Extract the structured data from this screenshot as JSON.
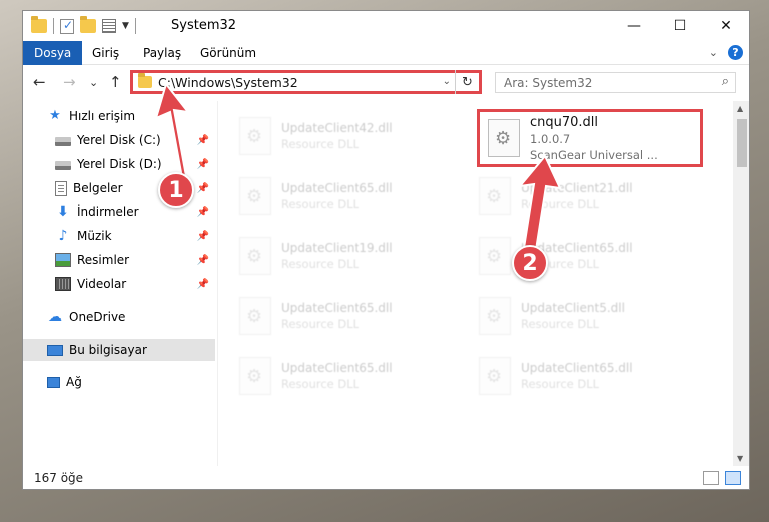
{
  "window": {
    "title": "System32",
    "controls": {
      "minimize": "—",
      "maximize": "☐",
      "close": "✕"
    }
  },
  "ribbon": {
    "tabs": [
      {
        "label": "Dosya",
        "active": true
      },
      {
        "label": "Giriş",
        "active": false
      },
      {
        "label": "Paylaş",
        "active": false
      },
      {
        "label": "Görünüm",
        "active": false
      }
    ],
    "help": "?",
    "collapse": "⌄"
  },
  "nav": {
    "back": "←",
    "forward": "→",
    "recent": "⌄",
    "up": "↑"
  },
  "address": {
    "path": "C:\\Windows\\System32",
    "dropdown": "⌄",
    "refresh": "↻"
  },
  "search": {
    "placeholder": "Ara: System32",
    "icon": "⌕"
  },
  "sidebar": {
    "items": [
      {
        "label": "Hızlı erişim",
        "icon": "star-icon",
        "pinned": false
      },
      {
        "label": "Yerel Disk (C:)",
        "icon": "disk-icon",
        "pinned": true
      },
      {
        "label": "Yerel Disk (D:)",
        "icon": "disk-icon",
        "pinned": true
      },
      {
        "label": "Belgeler",
        "icon": "document-icon",
        "pinned": true
      },
      {
        "label": "İndirmeler",
        "icon": "download-icon",
        "pinned": true
      },
      {
        "label": "Müzik",
        "icon": "music-icon",
        "pinned": true
      },
      {
        "label": "Resimler",
        "icon": "pictures-icon",
        "pinned": true
      },
      {
        "label": "Videolar",
        "icon": "videos-icon",
        "pinned": true
      },
      {
        "label": "OneDrive",
        "icon": "cloud-icon",
        "pinned": false
      },
      {
        "label": "Bu bilgisayar",
        "icon": "computer-icon",
        "pinned": false,
        "selected": true
      },
      {
        "label": "Ağ",
        "icon": "network-icon",
        "pinned": false
      }
    ],
    "pin_glyph": "📌"
  },
  "files": {
    "highlighted": {
      "name": "cnqu70.dll",
      "version": "1.0.0.7",
      "description": "ScanGear Universal ..."
    },
    "background": [
      {
        "name": "UpdateClient42.dll",
        "type": "Resource DLL"
      },
      {
        "name": "UpdateClient65.dll",
        "type": "Resource DLL"
      },
      {
        "name": "UpdateClient21.dll",
        "type": "Resource DLL"
      },
      {
        "name": "UpdateClient19.dll",
        "type": "Resource DLL"
      },
      {
        "name": "UpdateClient65.dll",
        "type": "Resource DLL"
      },
      {
        "name": "UpdateClient65.dll",
        "type": "Resource DLL"
      },
      {
        "name": "UpdateClient5.dll",
        "type": "Resource DLL"
      },
      {
        "name": "UpdateClient65.dll",
        "type": "Resource DLL"
      },
      {
        "name": "UpdateClient65.dll",
        "type": "Resource DLL"
      }
    ]
  },
  "status": {
    "item_count": "167 öğe"
  },
  "annotations": {
    "step1": "1",
    "step2": "2"
  },
  "colors": {
    "accent": "#1a5fb4",
    "highlight": "#e0474c"
  }
}
